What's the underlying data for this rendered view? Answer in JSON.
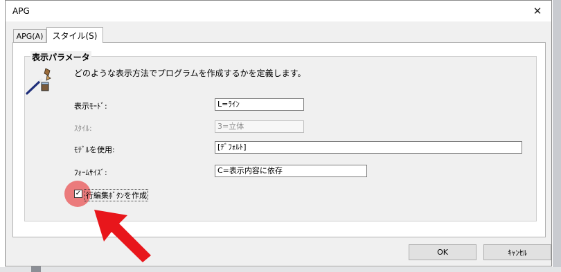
{
  "window": {
    "title": "APG",
    "close_glyph": "✕"
  },
  "tabs": [
    {
      "label": "APG(A)",
      "active": false
    },
    {
      "label": "スタイル(S)",
      "active": true
    }
  ],
  "group": {
    "title": "表示パラメータ",
    "description": "どのような表示方法でプログラムを作成するかを定義します。",
    "icon": "wand-tools-icon"
  },
  "fields": [
    {
      "label": "表示ﾓｰﾄﾞ:",
      "value": "L=ﾗｲﾝ",
      "enabled": true
    },
    {
      "label": "ｽﾀｲﾙ:",
      "value": "3=立体",
      "enabled": false
    },
    {
      "label": "ﾓﾃﾞﾙを使用:",
      "value": "[ﾃﾞﾌｫﾙﾄ]",
      "enabled": true
    },
    {
      "label": "ﾌｫｰﾑｻｲｽﾞ:",
      "value": "C=表示内容に依存",
      "enabled": true
    }
  ],
  "checkbox": {
    "label": "行編集ﾎﾞﾀﾝを作成",
    "checked": true,
    "glyph": "✓"
  },
  "buttons": {
    "ok": "OK",
    "cancel": "ｷｬﾝｾﾙ"
  },
  "colors": {
    "highlight": "#ea5455",
    "arrow": "#e8161b"
  }
}
